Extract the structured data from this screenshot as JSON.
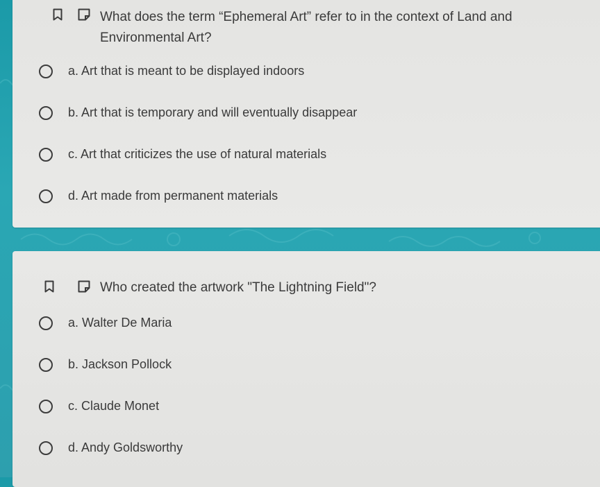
{
  "questions": [
    {
      "text_line1": "What does the term “Ephemeral Art” refer to in the context of Land and",
      "text_line2": "Environmental Art?",
      "options": [
        "a. Art that is meant to be displayed indoors",
        "b. Art that is temporary and will eventually disappear",
        "c. Art that criticizes the use of natural materials",
        "d. Art made from permanent materials"
      ]
    },
    {
      "text_line1": "Who created the artwork \"The Lightning Field\"?",
      "options": [
        "a. Walter De Maria",
        "b. Jackson Pollock",
        "c. Claude Monet",
        "d. Andy Goldsworthy"
      ]
    }
  ],
  "icons": {
    "bookmark": "bookmark-icon",
    "flag": "flag-icon",
    "radio": "radio-empty-icon"
  },
  "colors": {
    "background": "#2aa7b4",
    "card": "#e6e6e6",
    "text": "#3a3a3a"
  }
}
